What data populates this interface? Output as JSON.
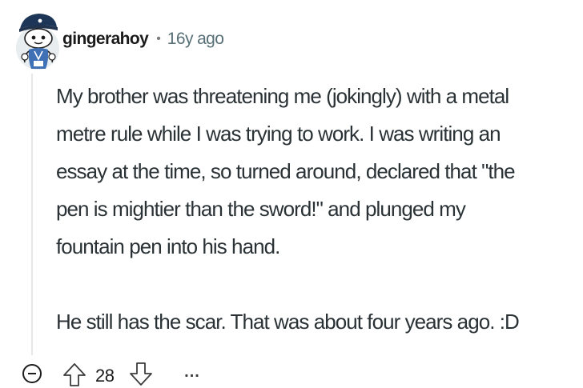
{
  "comment": {
    "author": "gingerahoy",
    "separator": "•",
    "age": "16y ago",
    "paragraphs": [
      "My brother was threatening me (jokingly) with a metal\nmetre rule while I was trying to work. I was writing an\nessay at the time, so turned around, declared that \"the\npen is mightier than the sword!\" and plunged my\nfountain pen into his hand.",
      "He still has the scar. That was about four years ago. :D"
    ],
    "votes": "28",
    "more_label": "..."
  },
  "icons": {
    "avatar": "snoo-avatar-icon",
    "collapse": "collapse-minus-icon",
    "upvote": "upvote-arrow-icon",
    "downvote": "downvote-arrow-icon",
    "more": "ellipsis-icon"
  },
  "colors": {
    "text": "#2a3236",
    "meta": "#576f76",
    "thread_line": "#e5e7e9",
    "avatar_bg": "#e8edf0"
  }
}
